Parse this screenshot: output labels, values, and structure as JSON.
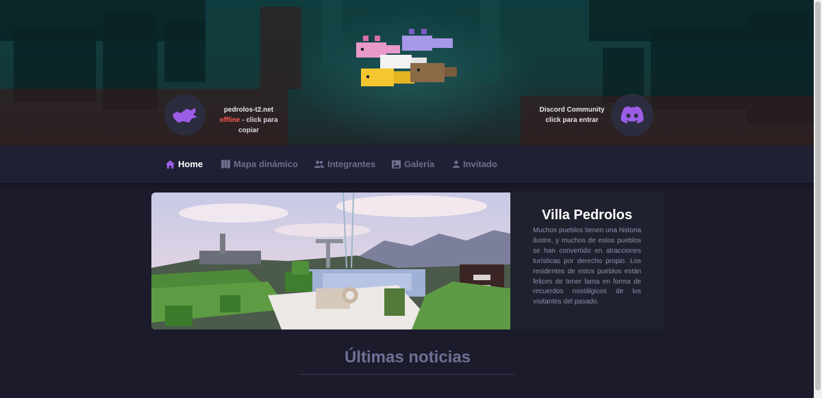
{
  "server": {
    "address": "pedrolos-t2.net",
    "status": "offline",
    "status_suffix": " - click para copiar",
    "status_color": "#ff5a5a"
  },
  "discord": {
    "title": "Discord Community",
    "subtitle": "click para entrar",
    "icon": "discord-icon",
    "accent": "#9b5de5"
  },
  "nav": {
    "items": [
      {
        "label": "Home",
        "icon": "home-icon",
        "active": true
      },
      {
        "label": "Mapa dinámico",
        "icon": "map-icon"
      },
      {
        "label": "Integrantes",
        "icon": "users-icon"
      },
      {
        "label": "Galería",
        "icon": "image-icon"
      },
      {
        "label": "Invitado",
        "icon": "user-icon"
      }
    ]
  },
  "hero": {
    "title": "Villa Pedrolos",
    "description": "Muchos pueblos tienen una historia ilustre, y muchos de estos pueblos se han convertido en atracciones turísticas por derecho propio. Los residentes de estos pueblos están felices de tener fama en forma de recuerdos nostálgicos de los visitantes del pasado."
  },
  "news": {
    "heading": "Últimas noticias"
  },
  "colors": {
    "background": "#1b1b2c",
    "nav_bg": "#1f2033",
    "accent_purple": "#9b5de5"
  }
}
